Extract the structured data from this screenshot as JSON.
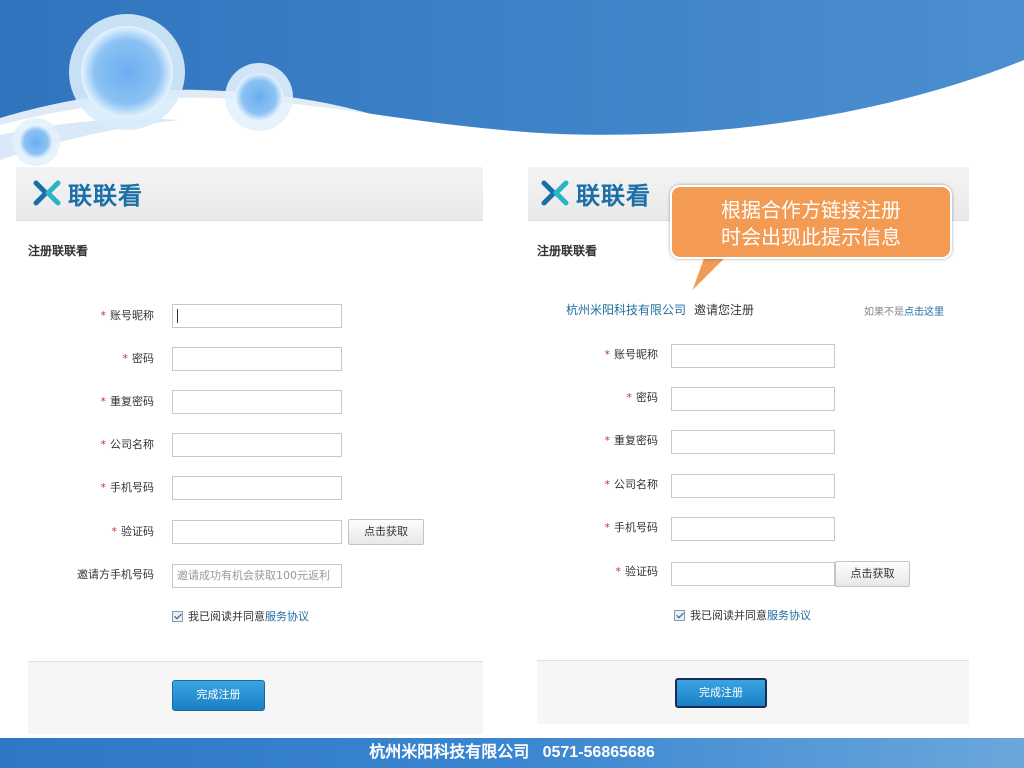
{
  "brand": {
    "logo_text": "联联看",
    "logo_color": "#1b6fa8"
  },
  "footer": {
    "text": "杭州米阳科技有限公司   0571-56865686"
  },
  "left_form": {
    "title": "注册联联看",
    "fields": [
      {
        "label": "账号昵称",
        "required": true,
        "value": "",
        "placeholder": ""
      },
      {
        "label": "密码",
        "required": true,
        "value": "",
        "placeholder": ""
      },
      {
        "label": "重复密码",
        "required": true,
        "value": "",
        "placeholder": ""
      },
      {
        "label": "公司名称",
        "required": true,
        "value": "",
        "placeholder": ""
      },
      {
        "label": "手机号码",
        "required": true,
        "value": "",
        "placeholder": ""
      },
      {
        "label": "验证码",
        "required": true,
        "value": "",
        "placeholder": ""
      },
      {
        "label": "邀请方手机号码",
        "required": false,
        "value": "",
        "placeholder": "邀请成功有机会获取100元返利"
      }
    ],
    "code_button": "点击获取",
    "agree_text": "我已阅读并同意",
    "agree_link": "服务协议",
    "agree_checked": true,
    "submit": "完成注册"
  },
  "right_form": {
    "title": "注册联联看",
    "invite_company": "杭州米阳科技有限公司",
    "invite_text": "邀请您注册",
    "not_me_text": "如果不是",
    "not_me_link": "点击这里",
    "fields": [
      {
        "label": "账号昵称",
        "required": true
      },
      {
        "label": "密码",
        "required": true
      },
      {
        "label": "重复密码",
        "required": true
      },
      {
        "label": "公司名称",
        "required": true
      },
      {
        "label": "手机号码",
        "required": true
      },
      {
        "label": "验证码",
        "required": true
      }
    ],
    "code_button": "点击获取",
    "agree_text": "我已阅读并同意",
    "agree_link": "服务协议",
    "agree_checked": true,
    "submit": "完成注册"
  },
  "callout": {
    "line1": "根据合作方链接注册",
    "line2": "时会出现此提示信息",
    "color": "#f39a53"
  },
  "colors": {
    "header_blue": "#3f82c4",
    "link": "#1f6d9e",
    "required": "#c0392b"
  }
}
